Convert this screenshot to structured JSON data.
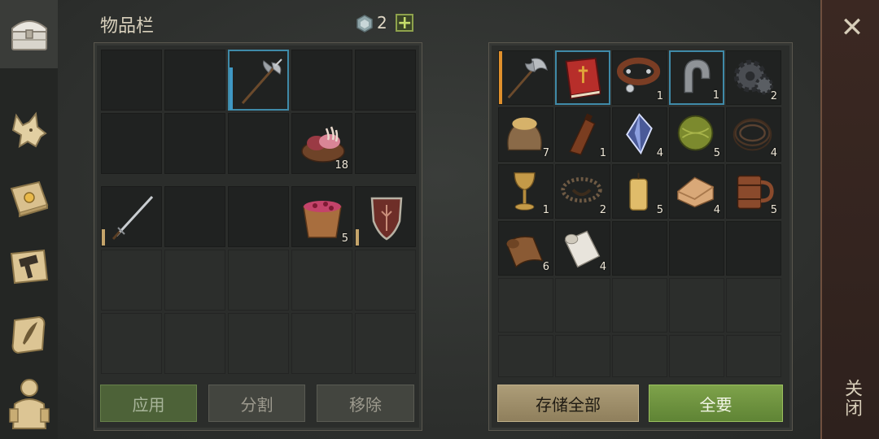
{
  "header": {
    "title": "物品栏",
    "currency_icon": "gem-icon",
    "currency_count": "2",
    "add_label": "+"
  },
  "sidebar": {
    "tabs": [
      {
        "name": "chest-tab",
        "icon": "chest-icon",
        "active": true
      },
      {
        "name": "wolf-tab",
        "icon": "wolf-icon"
      },
      {
        "name": "sun-book-tab",
        "icon": "sun-book-icon"
      },
      {
        "name": "hammer-map-tab",
        "icon": "hammer-map-icon"
      },
      {
        "name": "scroll-feather-tab",
        "icon": "scroll-feather-icon"
      },
      {
        "name": "character-tab",
        "icon": "character-icon"
      }
    ]
  },
  "close": {
    "icon": "close-icon",
    "label": "关闭"
  },
  "inventory": {
    "items": [
      {
        "slot": "r0c2",
        "name": "halberd",
        "icon": "halberd-icon",
        "count": "",
        "bar": "#3f98c4"
      },
      {
        "slot": "r1c3",
        "name": "raw-meat-bowl",
        "icon": "meat-bowl-icon",
        "count": "18"
      }
    ],
    "equipment": [
      {
        "slot": "sword",
        "icon": "sword-icon",
        "count": "",
        "bar": "#c4a46a"
      },
      {
        "slot": "empty1",
        "icon": "",
        "count": ""
      },
      {
        "slot": "empty2",
        "icon": "",
        "count": ""
      },
      {
        "slot": "berry-bucket",
        "icon": "berry-bucket-icon",
        "count": "5"
      },
      {
        "slot": "shield",
        "icon": "shield-icon",
        "count": "",
        "bar": "#c4a46a"
      }
    ]
  },
  "storage": {
    "items": [
      {
        "icon": "battle-axe-icon",
        "count": ""
      },
      {
        "icon": "red-book-icon",
        "count": ""
      },
      {
        "icon": "leather-collar-icon",
        "count": "1"
      },
      {
        "icon": "iron-horseshoe-icon",
        "count": "1"
      },
      {
        "icon": "gear-icon",
        "count": "2"
      },
      {
        "icon": "grain-sack-icon",
        "count": "7"
      },
      {
        "icon": "leather-flask-icon",
        "count": "1"
      },
      {
        "icon": "crystal-icon",
        "count": "4"
      },
      {
        "icon": "herb-ball-icon",
        "count": "5"
      },
      {
        "icon": "rope-icon",
        "count": "4"
      },
      {
        "icon": "goblet-icon",
        "count": "1"
      },
      {
        "icon": "bear-trap-icon",
        "count": "2"
      },
      {
        "icon": "candle-icon",
        "count": "5"
      },
      {
        "icon": "cloth-icon",
        "count": "4"
      },
      {
        "icon": "wooden-mug-icon",
        "count": "5"
      },
      {
        "icon": "leather-scroll-icon",
        "count": "6"
      },
      {
        "icon": "paper-roll-icon",
        "count": "4"
      }
    ]
  },
  "buttons": {
    "apply": "应用",
    "split": "分割",
    "remove": "移除",
    "store_all": "存储全部",
    "take_all": "全要"
  }
}
